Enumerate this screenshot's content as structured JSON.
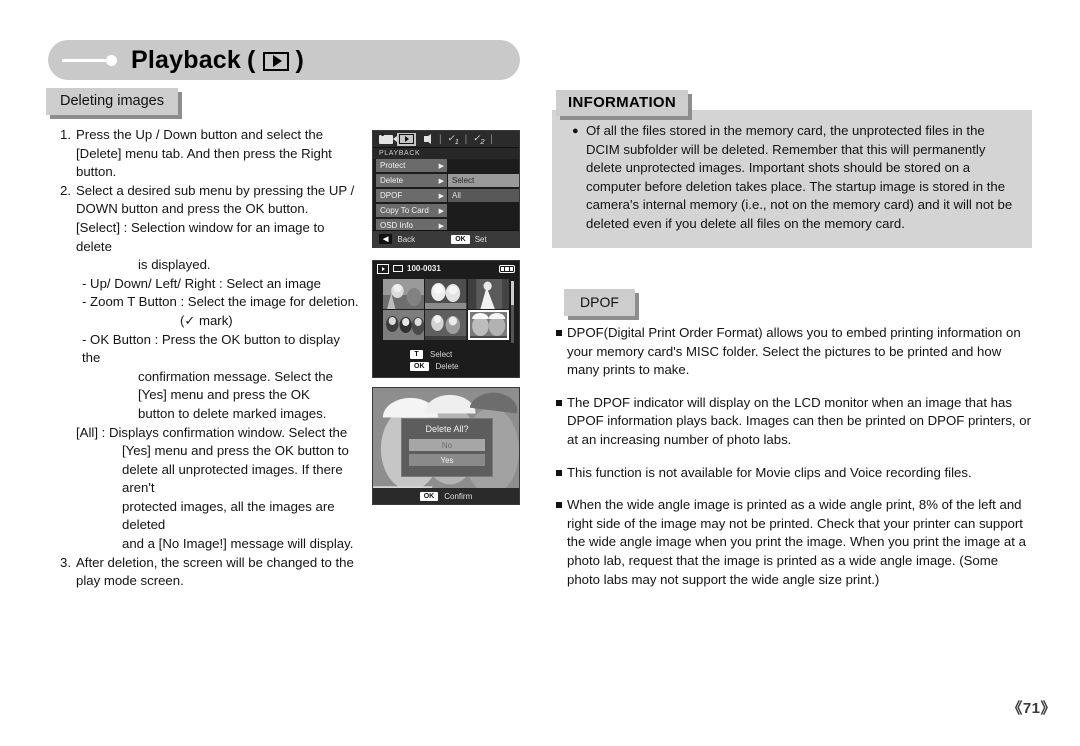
{
  "header": {
    "title": "Playback",
    "title_suffix_open": "(",
    "title_suffix_close": ")",
    "icon": "play-icon"
  },
  "section_tab": {
    "label": "Deleting images"
  },
  "instructions": {
    "steps": [
      {
        "num": "1.",
        "lines": [
          "Press the Up / Down button and select the",
          "[Delete] menu tab. And then press the Right",
          "button."
        ]
      },
      {
        "num": "2.",
        "lines": [
          "Select a desired sub menu by pressing the UP /",
          "DOWN button and press the OK button."
        ]
      }
    ],
    "select_label": "[Select] : Selection window for an image to delete",
    "select_label_cont": "is displayed.",
    "sub_points": [
      "- Up/ Down/ Left/ Right : Select an image",
      "- Zoom T Button : Select the image for deletion."
    ],
    "mark_note": "mark)",
    "mark_open": "(",
    "ok_button_label": "- OK Button : Press the OK button to display the",
    "ok_button_lines": [
      "confirmation message. Select the",
      "[Yes] menu and press the OK",
      "button to delete marked images."
    ],
    "all_label": "[All] : Displays confirmation window. Select the",
    "all_lines": [
      "[Yes] menu and press the OK button to",
      "delete all unprotected images. If there aren't",
      "protected images, all the images are deleted",
      "and a [No Image!] message will display."
    ],
    "step3": {
      "num": "3.",
      "lines": [
        "After deletion, the screen will be changed to the",
        "play mode screen."
      ]
    }
  },
  "lcd_menu": {
    "tabs": [
      {
        "icon": "movie-camera-icon",
        "active": false
      },
      {
        "icon": "playback-icon",
        "active": true
      },
      {
        "icon": "speaker-icon",
        "active": false
      },
      {
        "icon": "setup1-icon",
        "label": "1",
        "active": false
      },
      {
        "icon": "setup2-icon",
        "label": "2",
        "active": false
      }
    ],
    "caption": "PLAYBACK",
    "items": [
      "Protect",
      "Delete",
      "DPOF",
      "Copy To Card",
      "OSD Info"
    ],
    "submenu": [
      {
        "label": "Select",
        "selected": true
      },
      {
        "label": "All",
        "selected": false
      }
    ],
    "footer": {
      "back_key": "◀",
      "back_label": "Back",
      "ok_key": "OK",
      "ok_label": "Set"
    }
  },
  "lcd_thumbs": {
    "file_no": "100-0031",
    "keys": [
      {
        "key": "T",
        "label": "Select"
      },
      {
        "key": "OK",
        "label": "Delete"
      }
    ],
    "selected_index": 5
  },
  "lcd_confirm": {
    "title": "Delete All?",
    "options": [
      {
        "label": "No",
        "highlighted": true
      },
      {
        "label": "Yes",
        "highlighted": false
      }
    ],
    "footer_key": "OK",
    "footer_label": "Confirm"
  },
  "information": {
    "tab": "INFORMATION",
    "bullet": "●",
    "paragraphs": [
      "Of all the files stored in the memory card, the unprotected files in the DCIM subfolder will be deleted. Remember that this will permanently delete unprotected images. Important shots should be stored on a computer before deletion takes place. The startup image is stored in the camera's internal memory (i.e., not on the memory card) and it will not be deleted even if you delete all files on the memory card."
    ]
  },
  "dpof": {
    "tab": "DPOF",
    "items": [
      "DPOF(Digital Print Order Format) allows you to embed printing information on your memory card's MISC folder. Select the pictures to be printed and how many prints to make.",
      "The DPOF indicator will display on the LCD monitor when an image that has DPOF information plays back. Images can then be printed on DPOF printers, or at an increasing number of photo labs.",
      "This function is not available for Movie clips and Voice recording files.",
      "When the wide angle image is printed as a wide angle print, 8% of the left and right side of the image may not be printed. Check that your printer can support the wide angle image when you print the image. When you print the image at a photo lab, request that the image is printed as a wide angle image. (Some photo labs may not support the wide angle size print.)"
    ]
  },
  "page_number": "《71》",
  "colors": {
    "banner_bg": "#c9c9c9",
    "tab_bg": "#cdcdcd",
    "info_panel": "#d4d4d4",
    "lcd_bg": "#1c1c1c"
  }
}
